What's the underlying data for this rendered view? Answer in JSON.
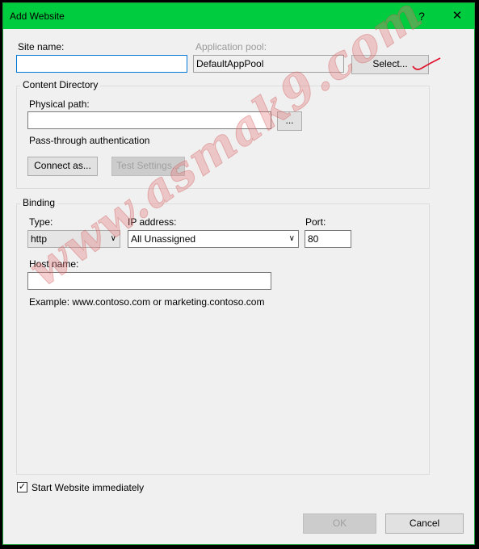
{
  "window": {
    "title": "Add Website",
    "help": "?",
    "close": "✕"
  },
  "site": {
    "name_label": "Site name:",
    "name_value": ""
  },
  "app_pool": {
    "label": "Application pool:",
    "value": "DefaultAppPool",
    "select_label": "Select..."
  },
  "content_directory": {
    "title": "Content Directory",
    "physical_path_label": "Physical path:",
    "physical_path_value": "",
    "browse_label": "...",
    "passthrough_label": "Pass-through authentication",
    "connect_as_label": "Connect as...",
    "test_settings_label": "Test Settings..."
  },
  "binding": {
    "title": "Binding",
    "type_label": "Type:",
    "type_value": "http",
    "ip_label": "IP address:",
    "ip_value": "All Unassigned",
    "port_label": "Port:",
    "port_value": "80",
    "host_label": "Host name:",
    "host_value": "",
    "example": "Example: www.contoso.com or marketing.contoso.com"
  },
  "start": {
    "label": "Start Website immediately",
    "checked": true,
    "check_glyph": "✓"
  },
  "footer": {
    "ok_label": "OK",
    "cancel_label": "Cancel"
  },
  "watermark": {
    "text": "www.asmak9.com"
  },
  "colors": {
    "titlebar": "#00cc3f",
    "focus": "#0078d7",
    "annotation": "#e0102a"
  }
}
